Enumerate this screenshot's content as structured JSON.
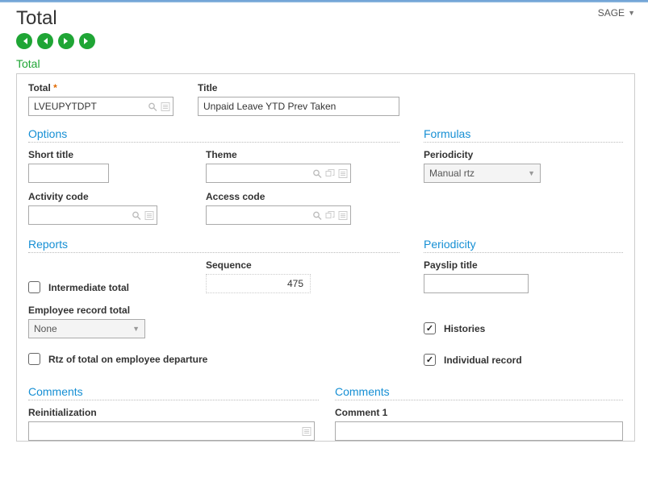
{
  "header": {
    "title": "Total",
    "user": "SAGE"
  },
  "panel_title": "Total",
  "total_field": {
    "label": "Total",
    "value": "LVEUPYTDPT"
  },
  "title_field": {
    "label": "Title",
    "value": "Unpaid Leave YTD Prev Taken"
  },
  "options": {
    "heading": "Options",
    "short_title": {
      "label": "Short title",
      "value": ""
    },
    "theme": {
      "label": "Theme",
      "value": ""
    },
    "activity_code": {
      "label": "Activity code",
      "value": ""
    },
    "access_code": {
      "label": "Access code",
      "value": ""
    }
  },
  "formulas": {
    "heading": "Formulas",
    "periodicity": {
      "label": "Periodicity",
      "value": "Manual rtz"
    }
  },
  "reports": {
    "heading": "Reports",
    "intermediate_total": {
      "label": "Intermediate total",
      "checked": false
    },
    "sequence": {
      "label": "Sequence",
      "value": "475"
    },
    "employee_record_total": {
      "label": "Employee record total",
      "value": "None"
    },
    "rtz": {
      "label": "Rtz of total on employee departure",
      "checked": false
    }
  },
  "periodicity": {
    "heading": "Periodicity",
    "payslip_title": {
      "label": "Payslip title",
      "value": ""
    },
    "histories": {
      "label": "Histories",
      "checked": true
    },
    "individual_record": {
      "label": "Individual record",
      "checked": true
    }
  },
  "comments_left": {
    "heading": "Comments",
    "reinitialization": {
      "label": "Reinitialization",
      "value": ""
    }
  },
  "comments_right": {
    "heading": "Comments",
    "comment1": {
      "label": "Comment 1",
      "value": ""
    }
  }
}
